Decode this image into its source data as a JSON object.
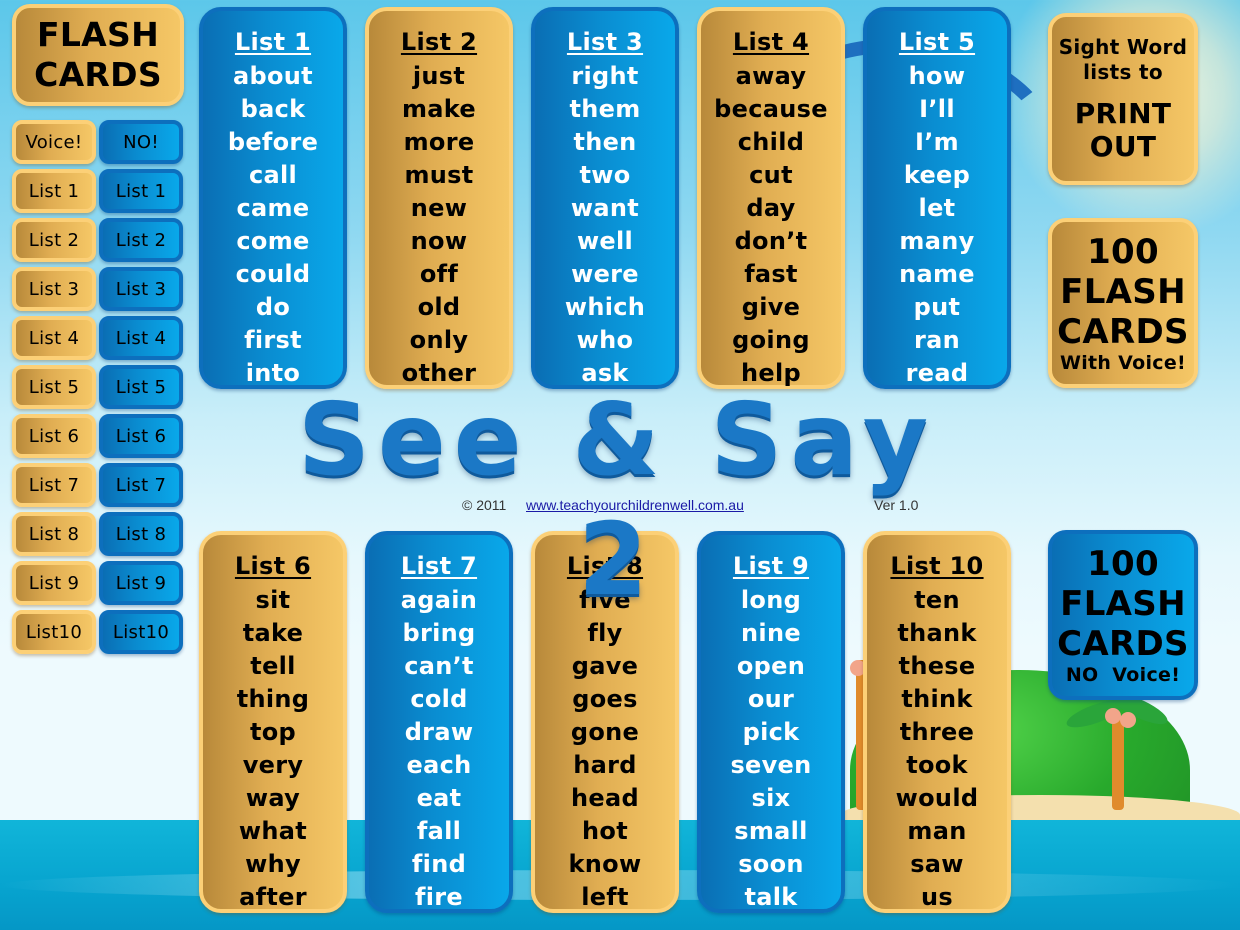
{
  "title": "See & Say 2",
  "footer": {
    "copyright": "© 2011",
    "link": "www.teachyourchildrenwell.com.au",
    "version": "Ver 1.0"
  },
  "sidebar": {
    "heading_line1": "FLASH",
    "heading_line2": "CARDS",
    "voice_label": "Voice!",
    "no_voice_label": "NO!",
    "voice_buttons": [
      "List 1",
      "List 2",
      "List 3",
      "List 4",
      "List 5",
      "List 6",
      "List 7",
      "List 8",
      "List 9",
      "List10"
    ],
    "no_voice_buttons": [
      "List 1",
      "List 2",
      "List 3",
      "List 4",
      "List 5",
      "List 6",
      "List 7",
      "List 8",
      "List 9",
      "List10"
    ]
  },
  "lists": [
    {
      "title": "List 1",
      "style": "blue",
      "words": [
        "about",
        "back",
        "before",
        "call",
        "came",
        "come",
        "could",
        "do",
        "first",
        "into"
      ]
    },
    {
      "title": "List 2",
      "style": "gold",
      "words": [
        "just",
        "make",
        "more",
        "must",
        "new",
        "now",
        "off",
        "old",
        "only",
        "other"
      ]
    },
    {
      "title": "List 3",
      "style": "blue",
      "words": [
        "right",
        "them",
        "then",
        "two",
        "want",
        "well",
        "were",
        "which",
        "who",
        "ask"
      ]
    },
    {
      "title": "List 4",
      "style": "gold",
      "words": [
        "away",
        "because",
        "child",
        "cut",
        "day",
        "don’t",
        "fast",
        "give",
        "going",
        "help"
      ]
    },
    {
      "title": "List 5",
      "style": "blue",
      "words": [
        "how",
        "I’ll",
        "I’m",
        "keep",
        "let",
        "many",
        "name",
        "put",
        "ran",
        "read"
      ]
    },
    {
      "title": "List 6",
      "style": "gold",
      "words": [
        "sit",
        "take",
        "tell",
        "thing",
        "top",
        "very",
        "way",
        "what",
        "why",
        "after"
      ]
    },
    {
      "title": "List 7",
      "style": "blue",
      "words": [
        "again",
        "bring",
        "can’t",
        "cold",
        "draw",
        "each",
        "eat",
        "fall",
        "find",
        "fire"
      ]
    },
    {
      "title": "List 8",
      "style": "gold",
      "words": [
        "five",
        "fly",
        "gave",
        "goes",
        "gone",
        "hard",
        "head",
        "hot",
        "know",
        "left"
      ]
    },
    {
      "title": "List 9",
      "style": "blue",
      "words": [
        "long",
        "nine",
        "open",
        "our",
        "pick",
        "seven",
        "six",
        "small",
        "soon",
        "talk"
      ]
    },
    {
      "title": "List 10",
      "style": "gold",
      "words": [
        "ten",
        "thank",
        "these",
        "think",
        "three",
        "took",
        "would",
        "man",
        "saw",
        "us"
      ]
    }
  ],
  "right_panel": {
    "print": {
      "line1": "Sight Word",
      "line2": "lists to",
      "line3": "PRINT",
      "line4": "OUT"
    },
    "flash_voice": {
      "line1": "100",
      "line2": "FLASH",
      "line3": "CARDS",
      "line4": "With Voice!"
    },
    "flash_no_voice": {
      "line1": "100",
      "line2": "FLASH",
      "line3": "CARDS",
      "line4": "NO  Voice!"
    }
  },
  "colors": {
    "gold": "#e0ad52",
    "blue": "#0a8cd0",
    "title_blue": "#1b78c6"
  }
}
